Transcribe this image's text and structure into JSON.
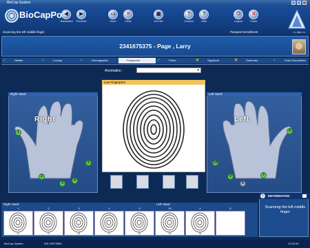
{
  "window": {
    "title": "BioCap System"
  },
  "app": {
    "logo_text": "BioCapPol",
    "status_line": "Scanning the left middle finger",
    "passport": "Passport Enrollment",
    "info_link": "<< Info >>"
  },
  "toolbar": {
    "backward": "Backward",
    "forward": "Forward",
    "save": "Save",
    "clear": "Clear",
    "ini": "Init HW",
    "context": "Context",
    "hide": "Hide",
    "logout": "Logout",
    "close": "Close"
  },
  "subject": {
    "id_name": "2341675375 - Page , Larry"
  },
  "tabs": [
    {
      "label": "Details",
      "state": "check"
    },
    {
      "label": "Lookup",
      "state": "check"
    },
    {
      "label": "Demographic",
      "state": "check"
    },
    {
      "label": "Fingerprint",
      "state": "active"
    },
    {
      "label": "Photo",
      "state": "check"
    },
    {
      "label": "Signature",
      "state": "x"
    },
    {
      "label": "Summary",
      "state": "x"
    },
    {
      "label": "Scan Documents",
      "state": "check"
    }
  ],
  "anomalies": {
    "label": "Anomalies :",
    "value": ""
  },
  "panels": {
    "right_hand": "Right Hand",
    "left_hand": "Left Hand",
    "live_fingerprint": "Live Fingerprint"
  },
  "hands": {
    "right_word": "Right",
    "left_word": "Left"
  },
  "fingers_right": [
    "1",
    "2",
    "3",
    "4",
    "5"
  ],
  "fingers_left": [
    "6",
    "7",
    "8",
    "9",
    "10"
  ],
  "bottom": {
    "right_hand": "Right Hand",
    "left_hand": "Left Hand",
    "slots": [
      {
        "num": "1",
        "score": "61"
      },
      {
        "num": "2",
        "score": "70"
      },
      {
        "num": "3",
        "score": "58"
      },
      {
        "num": "4",
        "score": "67"
      },
      {
        "num": "5",
        "score": "84"
      },
      {
        "num": "10",
        "score": "68"
      },
      {
        "num": "9",
        "score": "66"
      },
      {
        "num": "8",
        "score": ""
      }
    ]
  },
  "info": {
    "title": "INFORMATION",
    "message": "Scanning the  left middle finger"
  },
  "statusbar": {
    "left": "BioCap System",
    "middle": "WS-75573963",
    "time": "12:31:54"
  }
}
